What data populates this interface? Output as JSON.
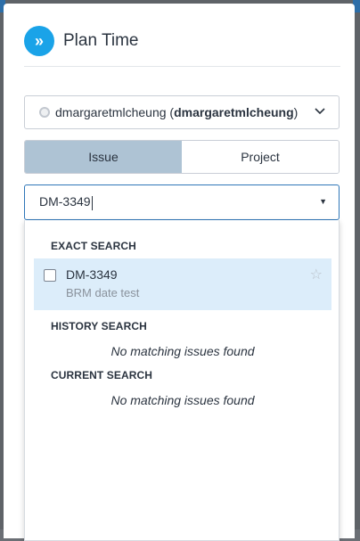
{
  "header": {
    "title": "Plan Time",
    "icon": "chevrons-right-icon"
  },
  "user_select": {
    "display_name": "dmargaretmlcheung",
    "username": "dmargaretmlcheung"
  },
  "scope_toggle": {
    "options": [
      "Issue",
      "Project"
    ],
    "active": "Issue"
  },
  "search": {
    "value": "DM-3349"
  },
  "dropdown": {
    "exact_heading": "EXACT SEARCH",
    "exact_results": [
      {
        "key": "DM-3349",
        "summary": "BRM date test"
      }
    ],
    "history_heading": "HISTORY SEARCH",
    "history_empty": "No matching issues found",
    "current_heading": "CURRENT SEARCH",
    "current_empty": "No matching issues found"
  },
  "colors": {
    "accent": "#1aa3e8",
    "active_segment": "#aec3d4",
    "focus_border": "#2f77b8",
    "row_highlight": "#dcedfa"
  }
}
